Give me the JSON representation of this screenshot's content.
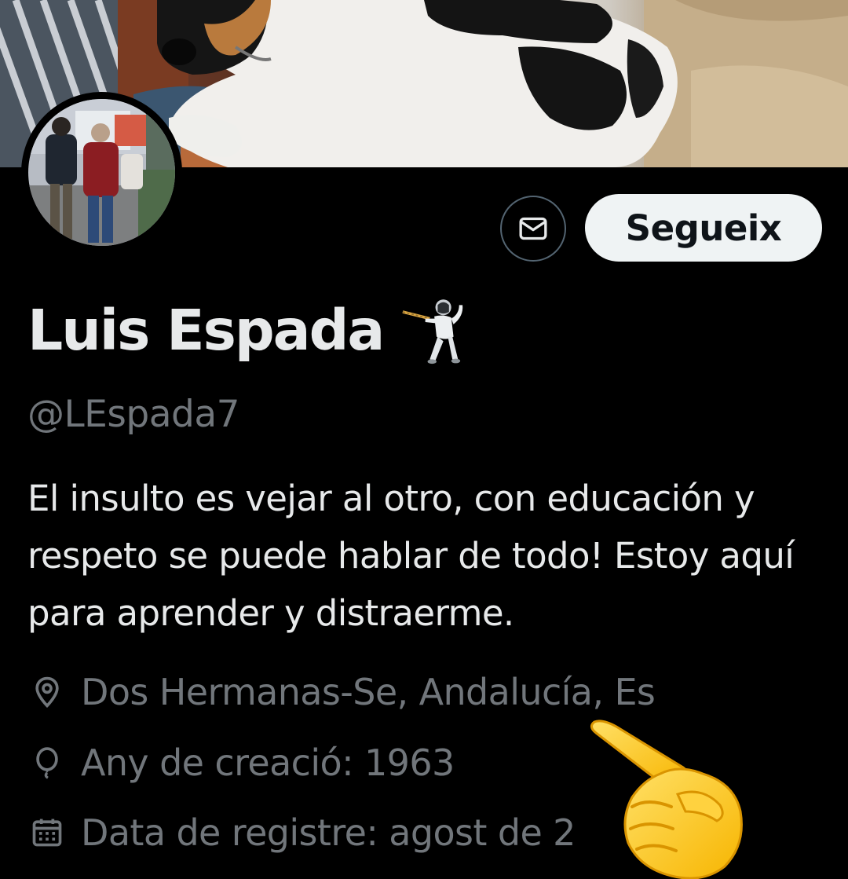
{
  "profile": {
    "display_name": "Luis Espada",
    "handle": "@LEspada7",
    "bio": "El insulto es vejar al otro, con educación y respeto se puede hablar de todo! Estoy aquí para aprender y distraerme.",
    "location": "Dos Hermanas-Se, Andalucía, Es",
    "birth": "Any de creació: 1963",
    "joined": "Data de registre: agost de 2"
  },
  "actions": {
    "follow_label": "Segueix"
  },
  "icons": {
    "message": "envelope-icon",
    "name_emoji": "fencer-emoji",
    "location": "location-pin-icon",
    "birth": "balloon-icon",
    "joined": "calendar-icon",
    "overlay": "pointing-hand-emoji"
  },
  "colors": {
    "background": "#000000",
    "primary_text": "#e7e9ea",
    "secondary_text": "#71767b",
    "button_bg": "#eff3f4",
    "button_text": "#0f1419",
    "outline": "#536471"
  }
}
